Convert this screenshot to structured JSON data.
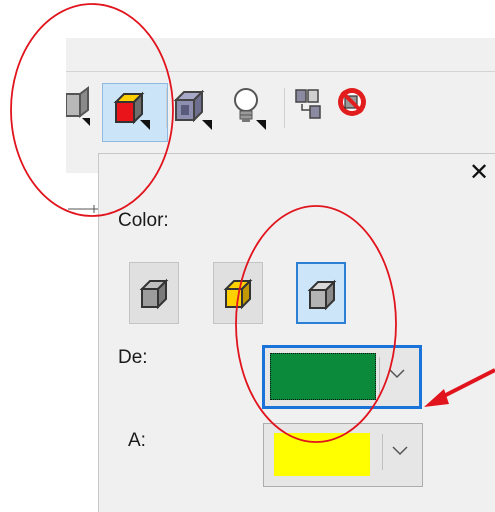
{
  "toolbar": {
    "buttons": [
      {
        "name": "partial-cube-icon"
      },
      {
        "name": "color-cube-icon"
      },
      {
        "name": "shaded-cube-icon"
      },
      {
        "name": "lighting-bulb-icon"
      },
      {
        "name": "copy-properties-icon"
      },
      {
        "name": "clear-effect-icon"
      }
    ]
  },
  "popup": {
    "section_label": "Color:",
    "close_glyph": "✕",
    "from_label": "De:",
    "to_label": "A:",
    "from_color": "#0b8a3c",
    "to_color": "#ffff00"
  },
  "colors": {
    "annotation_red": "#e1141d",
    "focus_blue": "#1a73d9"
  }
}
